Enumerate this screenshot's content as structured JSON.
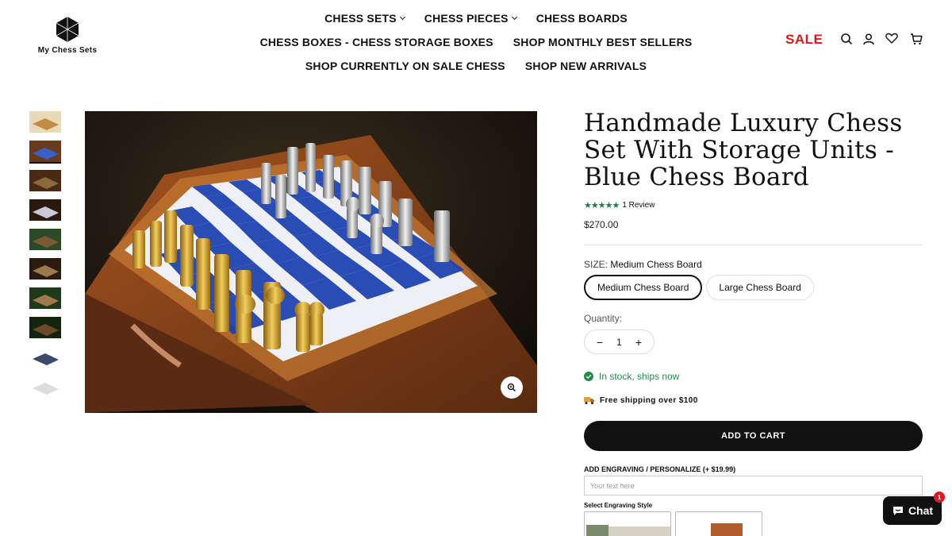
{
  "brand": {
    "name": "My Chess Sets"
  },
  "nav": {
    "row1": [
      {
        "label": "CHESS SETS",
        "dropdown": true
      },
      {
        "label": "CHESS PIECES",
        "dropdown": true
      },
      {
        "label": "CHESS BOARDS",
        "dropdown": false
      }
    ],
    "row2": [
      {
        "label": "CHESS BOXES - CHESS STORAGE BOXES"
      },
      {
        "label": "SHOP MONTHLY BEST SELLERS"
      }
    ],
    "row3": [
      {
        "label": "SHOP CURRENTLY ON SALE CHESS"
      },
      {
        "label": "SHOP NEW ARRIVALS"
      }
    ]
  },
  "header": {
    "sale_label": "SALE",
    "icons": [
      "search-icon",
      "account-icon",
      "wishlist-heart-icon",
      "cart-icon"
    ]
  },
  "product": {
    "title": "Handmade Luxury Chess Set With Storage Units - Blue Chess Board",
    "rating_stars": 5,
    "review_text": "1 Review",
    "price": "$270.00",
    "size_label": "SIZE:",
    "size_selected": "Medium Chess Board",
    "size_options": [
      "Medium Chess Board",
      "Large Chess Board"
    ],
    "quantity_label": "Quantity:",
    "quantity": "1",
    "stock_text": "In stock, ships now",
    "shipping_text": "Free shipping over $100",
    "add_to_cart": "ADD TO CART",
    "engraving_label": "ADD ENGRAVING / PERSONALIZE",
    "engraving_price": "(+ $19.99)",
    "engraving_placeholder": "Your text here",
    "engraving_style_label": "Select Engraving Style"
  },
  "gallery": {
    "thumbnail_count": 10,
    "active_index": 1
  },
  "chat": {
    "label": "Chat",
    "badge": "1"
  },
  "colors": {
    "sale": "#e0171f",
    "stock": "#1e8d4d",
    "stars": "#1f7a4d",
    "button": "#111111"
  }
}
